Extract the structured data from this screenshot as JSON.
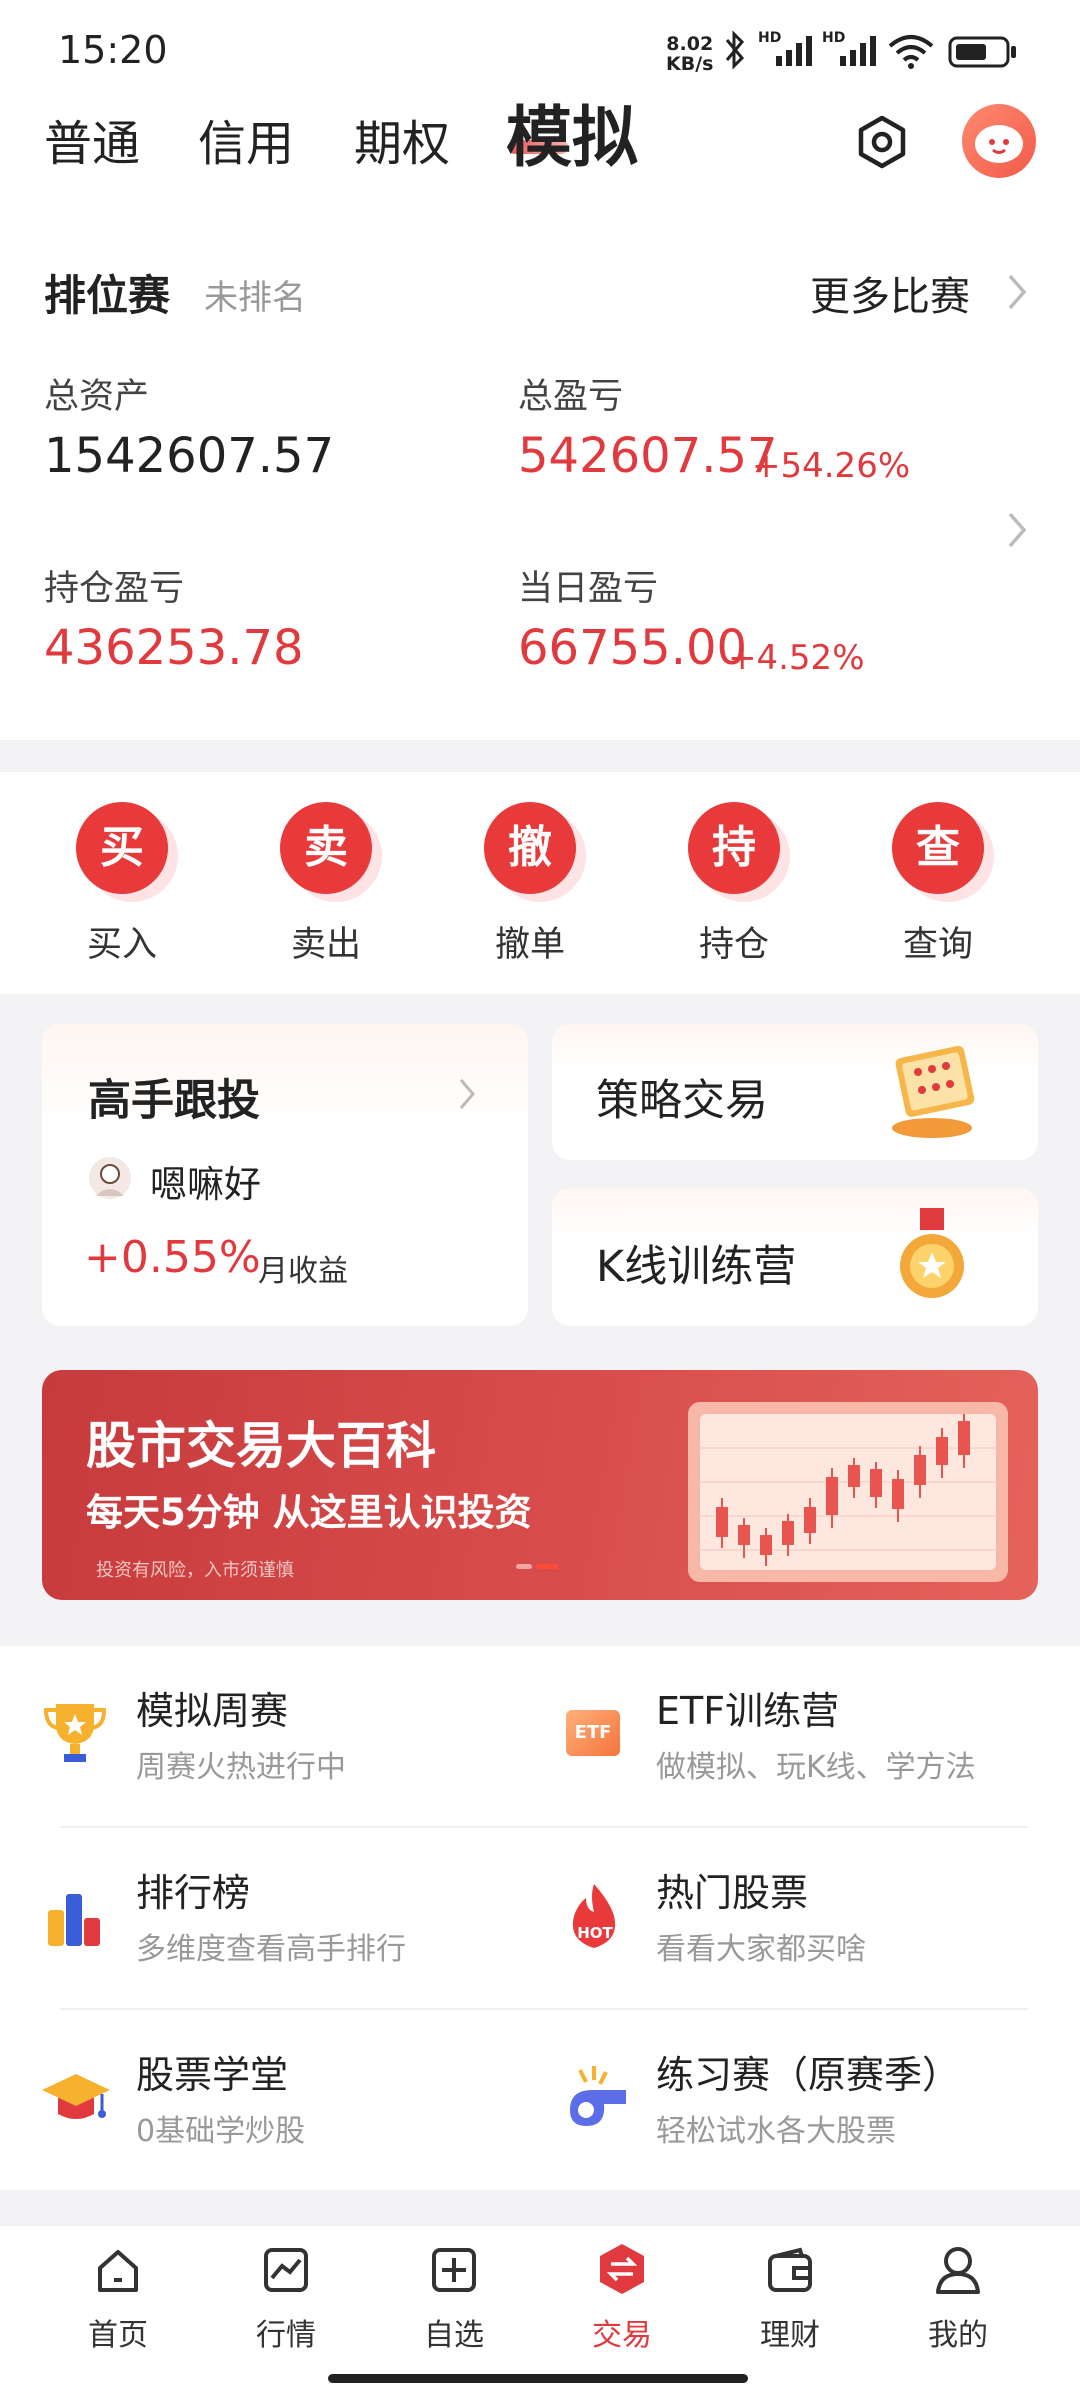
{
  "status_bar": {
    "time": "15:20",
    "speed_value": "8.02",
    "speed_unit": "KB/s",
    "signal_label_1": "HD",
    "signal_label_2": "HD"
  },
  "top_tabs": [
    "普通",
    "信用",
    "期权",
    "模拟"
  ],
  "rank": {
    "title": "排位赛",
    "status": "未排名",
    "more": "更多比赛"
  },
  "account": {
    "total_assets_label": "总资产",
    "total_assets": "1542607.57",
    "total_pnl_label": "总盈亏",
    "total_pnl": "542607.57",
    "total_pnl_pct": "+54.26%",
    "position_pnl_label": "持仓盈亏",
    "position_pnl": "436253.78",
    "daily_pnl_label": "当日盈亏",
    "daily_pnl": "66755.00",
    "daily_pnl_pct": "+4.52%"
  },
  "actions": [
    {
      "icon_char": "买",
      "label": "买入"
    },
    {
      "icon_char": "卖",
      "label": "卖出"
    },
    {
      "icon_char": "撤",
      "label": "撤单"
    },
    {
      "icon_char": "持",
      "label": "持仓"
    },
    {
      "icon_char": "查",
      "label": "查询"
    }
  ],
  "features": {
    "follow": {
      "title": "高手跟投",
      "user": "嗯嘛好",
      "return": "+0.55%",
      "return_label": "月收益"
    },
    "strategy": "策略交易",
    "kline": "K线训练营"
  },
  "banner": {
    "title": "股市交易大百科",
    "subtitle": "每天5分钟 从这里认识投资",
    "note": "投资有风险，入市须谨慎"
  },
  "grid_items": [
    {
      "title": "模拟周赛",
      "sub": "周赛火热进行中",
      "icon": "trophy-icon"
    },
    {
      "title": "ETF训练营",
      "sub": "做模拟、玩K线、学方法",
      "icon": "etf-icon",
      "icon_text": "ETF"
    },
    {
      "title": "排行榜",
      "sub": "多维度查看高手排行",
      "icon": "bar-chart-icon"
    },
    {
      "title": "热门股票",
      "sub": "看看大家都买啥",
      "icon": "hot-flame-icon",
      "icon_text": "HOT"
    },
    {
      "title": "股票学堂",
      "sub": "0基础学炒股",
      "icon": "graduation-cap-icon"
    },
    {
      "title": "练习赛（原赛季）",
      "sub": "轻松试水各大股票",
      "icon": "whistle-icon"
    }
  ],
  "tabbar": [
    {
      "label": "首页",
      "icon": "home-icon"
    },
    {
      "label": "行情",
      "icon": "chart-icon"
    },
    {
      "label": "自选",
      "icon": "add-square-icon"
    },
    {
      "label": "交易",
      "icon": "trade-icon",
      "active": true
    },
    {
      "label": "理财",
      "icon": "wallet-icon"
    },
    {
      "label": "我的",
      "icon": "profile-icon"
    }
  ],
  "colors": {
    "accent_red": "#e0393e",
    "action_red": "#e8393b",
    "muted_text": "#999999"
  }
}
